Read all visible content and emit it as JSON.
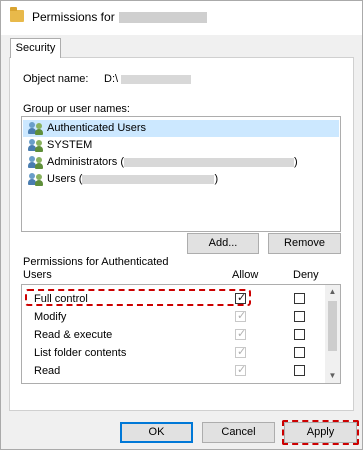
{
  "window": {
    "title": "Permissions for"
  },
  "tabs": [
    {
      "label": "Security"
    }
  ],
  "object": {
    "label": "Object name:",
    "value": "D:\\"
  },
  "groups": {
    "label": "Group or user names:",
    "items": [
      {
        "label": "Authenticated Users",
        "icon": "users-group-icon",
        "selected": true
      },
      {
        "label": "SYSTEM",
        "icon": "users-group-icon"
      },
      {
        "label": "Administrators (",
        "suffix": ")",
        "icon": "users-group-icon"
      },
      {
        "label": "Users (",
        "suffix": ")",
        "icon": "users-group-icon"
      }
    ]
  },
  "buttons": {
    "add": "Add...",
    "remove": "Remove",
    "ok": "OK",
    "cancel": "Cancel",
    "apply": "Apply"
  },
  "permissions": {
    "label_line1": "Permissions for Authenticated",
    "label_line2": "Users",
    "allow_header": "Allow",
    "deny_header": "Deny",
    "rows": [
      {
        "name": "Full control",
        "allow": true,
        "deny": false
      },
      {
        "name": "Modify",
        "allow": true,
        "deny": false
      },
      {
        "name": "Read & execute",
        "allow": true,
        "deny": false
      },
      {
        "name": "List folder contents",
        "allow": true,
        "deny": false
      },
      {
        "name": "Read",
        "allow": true,
        "deny": false
      }
    ]
  },
  "colors": {
    "highlight": "#cc0000",
    "selection": "#cce8ff",
    "accent": "#0078d7"
  }
}
